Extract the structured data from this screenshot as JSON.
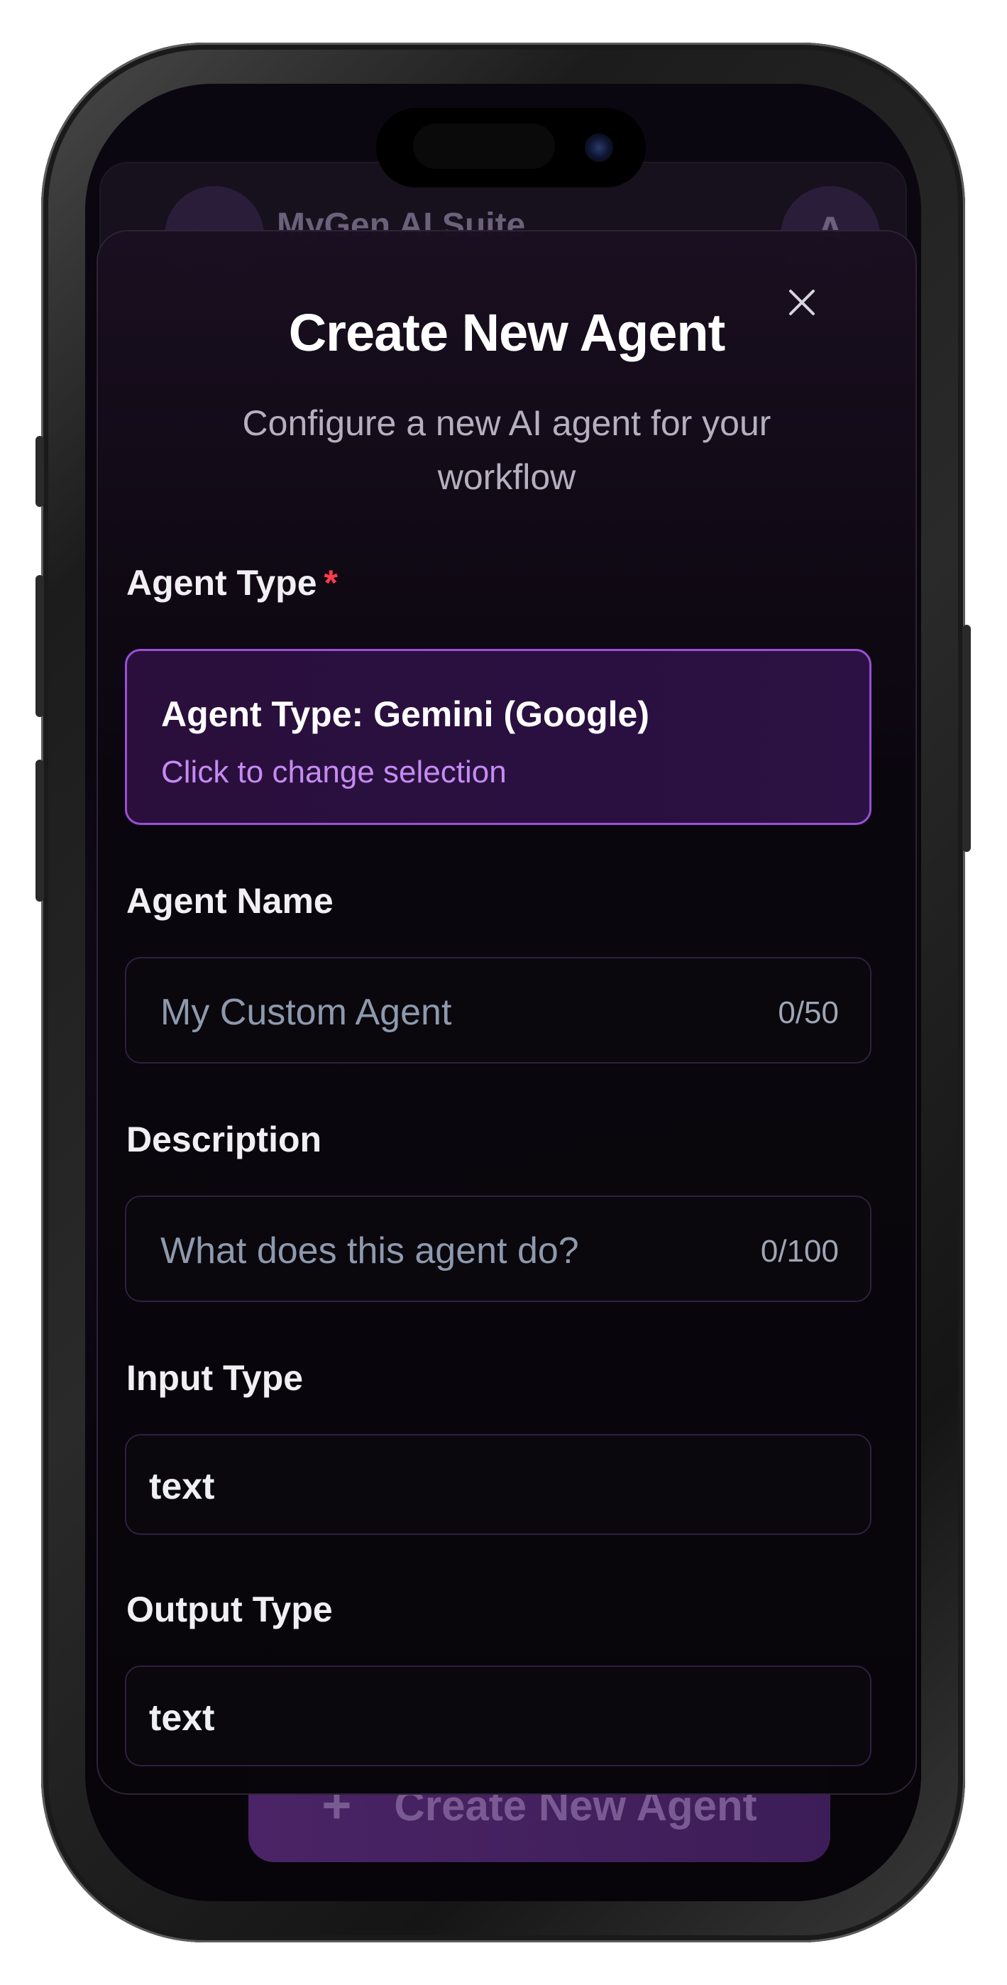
{
  "background_app": {
    "header_title": "MyGen AI Suite",
    "header_initial": "A",
    "bottom_button_label": "Create New Agent",
    "bottom_button_icon": "plus-icon"
  },
  "modal": {
    "title": "Create New Agent",
    "subtitle": "Configure a new AI agent for your workflow",
    "close_icon": "close-icon",
    "agent_type": {
      "label": "Agent Type",
      "required_mark": "*",
      "selected_text": "Agent Type: Gemini (Google)",
      "hint": "Click to change selection"
    },
    "agent_name": {
      "label": "Agent Name",
      "placeholder": "My Custom Agent",
      "counter": "0/50"
    },
    "description": {
      "label": "Description",
      "placeholder": "What does this agent do?",
      "counter": "0/100"
    },
    "input_type": {
      "label": "Input Type",
      "value": "text"
    },
    "output_type": {
      "label": "Output Type",
      "value": "text"
    }
  },
  "colors": {
    "accent": "#9b4fd6",
    "accent_text": "#c58bf2",
    "required": "#ff3d4a",
    "background": "#07040a"
  }
}
